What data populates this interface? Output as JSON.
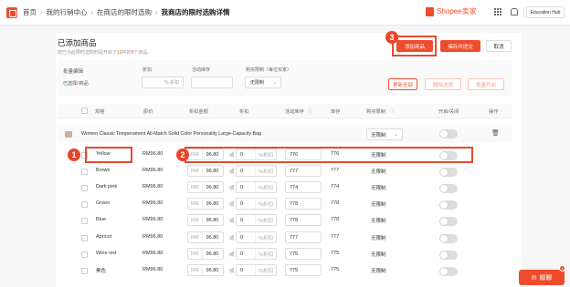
{
  "breadcrumb": {
    "home": "首页",
    "marketing": "我的行销中心",
    "flash_sale": "在商店的限时选购",
    "current": "我商店的限时选购详情"
  },
  "brand": {
    "name": "Shopee卖家"
  },
  "header": {
    "hub_label": "Education Hub"
  },
  "page": {
    "title": "已添加商品",
    "subtitle_pre": "您已为此限时选购时段开启了",
    "subtitle_count1": "10",
    "subtitle_mid": "中的",
    "subtitle_count2": "0",
    "subtitle_post": "个商品。"
  },
  "actions": {
    "add": "添加商品",
    "save": "储存并提交",
    "cancel": "取消"
  },
  "batch": {
    "title": "批量编辑",
    "selected_pre": "已选择",
    "selected_count": "0",
    "selected_post": "商品",
    "discount_label": "折扣",
    "discount_placeholder": "% 折扣",
    "stock_label": "活动库存",
    "limit_label": "购买限制（每位买家）",
    "limit_value": "无限制",
    "update_all": "更新全部",
    "delete_selected": "删除选择",
    "enable_batch": "批量开启"
  },
  "columns": [
    "规格",
    "原价",
    "折扣金额",
    "折扣",
    "活动库存",
    "库存",
    "购买限制",
    "开启/关闭",
    "操作"
  ],
  "product": {
    "name": "Women Classic Temperament All-Match Solid Color Personality Large-Capacity Bag",
    "limit": "无限制"
  },
  "variants": [
    {
      "name": "Yellow",
      "price": "RM96.80",
      "sale": "96.80",
      "discount": "0",
      "campaign_stock": "776",
      "stock": "776",
      "limit": "无限制",
      "on": false
    },
    {
      "name": "Brown",
      "price": "RM96.80",
      "sale": "96.80",
      "discount": "0",
      "campaign_stock": "777",
      "stock": "777",
      "limit": "无限制",
      "on": false
    },
    {
      "name": "Dark pink",
      "price": "RM96.80",
      "sale": "96.80",
      "discount": "0",
      "campaign_stock": "774",
      "stock": "774",
      "limit": "无限制",
      "on": false
    },
    {
      "name": "Green",
      "price": "RM96.80",
      "sale": "96.80",
      "discount": "0",
      "campaign_stock": "778",
      "stock": "778",
      "limit": "无限制",
      "on": false
    },
    {
      "name": "Blue",
      "price": "RM96.80",
      "sale": "96.80",
      "discount": "0",
      "campaign_stock": "778",
      "stock": "778",
      "limit": "无限制",
      "on": false
    },
    {
      "name": "Apricot",
      "price": "RM96.80",
      "sale": "96.80",
      "discount": "0",
      "campaign_stock": "777",
      "stock": "777",
      "limit": "无限制",
      "on": false
    },
    {
      "name": "Wine red",
      "price": "RM96.80",
      "sale": "96.80",
      "discount": "0",
      "campaign_stock": "775",
      "stock": "775",
      "limit": "无限制",
      "on": false
    },
    {
      "name": "黑色",
      "price": "RM96.80",
      "sale": "96.80",
      "discount": "0",
      "campaign_stock": "775",
      "stock": "775",
      "limit": "无限制",
      "on": false
    }
  ],
  "input_labels": {
    "currency": "RM",
    "or": "或",
    "percent_off": "%折扣"
  },
  "callouts": [
    "1",
    "2",
    "3"
  ],
  "chat": {
    "label": "聊聊",
    "badge": "1"
  },
  "colors": {
    "accent": "#ee4d2d",
    "callout": "#e8462a"
  }
}
